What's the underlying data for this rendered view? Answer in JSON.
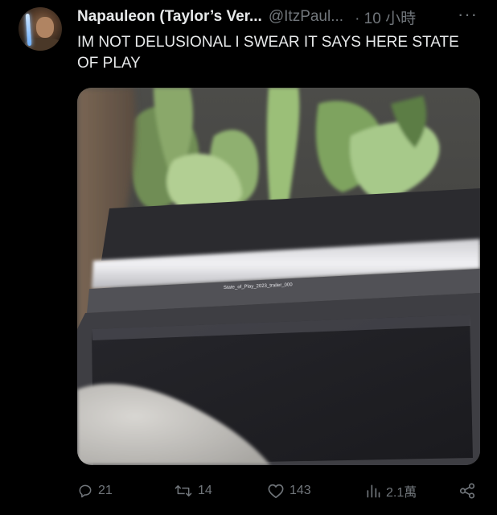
{
  "tweet": {
    "display_name": "Napauleon (Taylor’s Ver...",
    "handle": "@ItzPaul...",
    "time_separator": "·",
    "time": "10 小時",
    "more_label": "···",
    "text": "IM NOT DELUSIONAL I SWEAR IT SAYS HERE STATE OF PLAY",
    "media": {
      "screen_caption": "State_of_Play_2023_trailer_000"
    }
  },
  "actions": {
    "reply_count": "21",
    "retweet_count": "14",
    "like_count": "143",
    "views_count": "2.1萬"
  },
  "icons": {
    "reply": "reply-icon",
    "retweet": "retweet-icon",
    "like": "heart-icon",
    "views": "views-icon",
    "share": "share-icon",
    "more": "more-icon"
  },
  "colors": {
    "background": "#000000",
    "text_primary": "#e7e9ea",
    "text_secondary": "#71767b"
  }
}
